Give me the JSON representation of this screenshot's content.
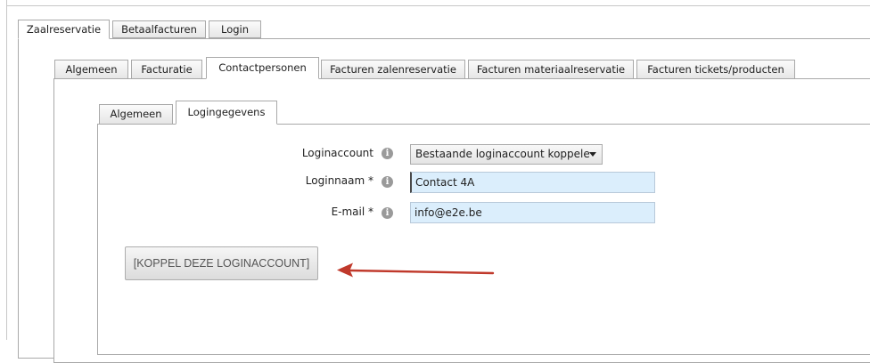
{
  "top_tabs": [
    {
      "label": "Zaalreservatie",
      "active": true
    },
    {
      "label": "Betaalfacturen",
      "active": false
    },
    {
      "label": "Login",
      "active": false
    }
  ],
  "sub_tabs": [
    {
      "label": "Algemeen",
      "active": false
    },
    {
      "label": "Facturatie",
      "active": false
    },
    {
      "label": "Contactpersonen",
      "active": true
    },
    {
      "label": "Facturen zalenreservatie",
      "active": false
    },
    {
      "label": "Facturen materiaalreservatie",
      "active": false
    },
    {
      "label": "Facturen tickets/producten",
      "active": false
    }
  ],
  "inner_tabs": [
    {
      "label": "Algemeen",
      "active": false
    },
    {
      "label": "Logingegevens",
      "active": true
    }
  ],
  "form": {
    "loginaccount": {
      "label": "Loginaccount",
      "value": "Bestaande loginaccount koppele"
    },
    "loginnaam": {
      "label": "Loginnaam *",
      "value": "Contact 4A"
    },
    "email": {
      "label": "E-mail *",
      "value": "info@e2e.be"
    }
  },
  "info_glyph": "i",
  "koppel_button": "[KOPPEL DEZE LOGINACCOUNT]",
  "colors": {
    "arrow": "#c0392b",
    "field_bg": "#dbeefc"
  }
}
